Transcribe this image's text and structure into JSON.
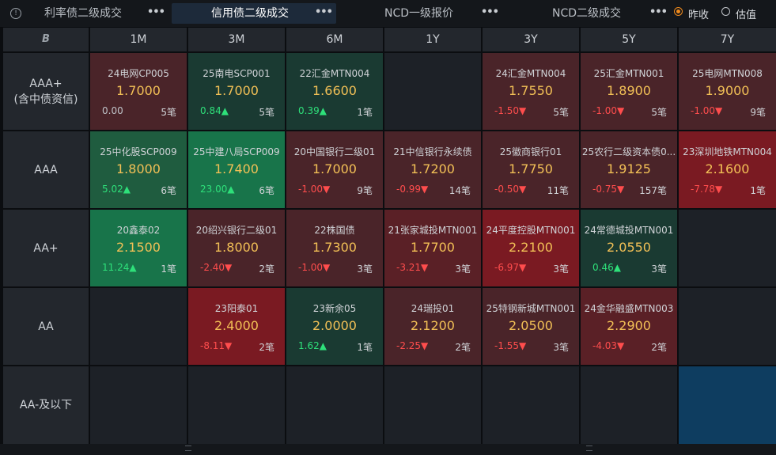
{
  "tabs": [
    {
      "label": "利率债二级成交",
      "dots": "•••"
    },
    {
      "label": "信用债二级成交",
      "dots": "•••"
    },
    {
      "label": "NCD一级报价",
      "dots": "•••"
    },
    {
      "label": "NCD二级成交",
      "dots": "•••"
    }
  ],
  "radios": {
    "option1": "昨收",
    "option2": "估值",
    "selected": "昨收"
  },
  "corner_icon": "B",
  "tenors": [
    "1M",
    "3M",
    "6M",
    "1Y",
    "3Y",
    "5Y",
    "7Y"
  ],
  "ratings": [
    "AAA+\n(含中债资信)",
    "AAA",
    "AA+",
    "AA",
    "AA-及以下"
  ],
  "colors": {
    "green_strong": "#18744a",
    "green_dark": "#1a3a32",
    "red_strong": "#7a1a22",
    "red_dark": "#4a2429",
    "empty": "#1d2127",
    "blue": "#0e3d60",
    "price": "#f2c056",
    "up": "#2ee07a",
    "down": "#ff4d4d"
  },
  "cells": [
    [
      {
        "name": "24电网CP005",
        "price": "1.7000",
        "change": "0.00",
        "dir": "flat",
        "count": "5笔",
        "tone": "red_dark"
      },
      {
        "name": "25南电SCP001",
        "price": "1.7000",
        "change": "0.84▲",
        "dir": "up",
        "count": "5笔",
        "tone": "green_dark"
      },
      {
        "name": "22汇金MTN004",
        "price": "1.6600",
        "change": "0.39▲",
        "dir": "up",
        "count": "1笔",
        "tone": "green_dark"
      },
      {
        "tone": "empty"
      },
      {
        "name": "24汇金MTN004",
        "price": "1.7550",
        "change": "-1.50▼",
        "dir": "down",
        "count": "5笔",
        "tone": "red_dark"
      },
      {
        "name": "25汇金MTN001",
        "price": "1.8900",
        "change": "-1.00▼",
        "dir": "down",
        "count": "5笔",
        "tone": "red_dark"
      },
      {
        "name": "25电网MTN008",
        "price": "1.9000",
        "change": "-1.00▼",
        "dir": "down",
        "count": "9笔",
        "tone": "red_dark"
      }
    ],
    [
      {
        "name": "25中化股SCP009",
        "price": "1.8000",
        "change": "5.02▲",
        "dir": "up",
        "count": "6笔",
        "tone": "green_mid"
      },
      {
        "name": "25中建八局SCP009",
        "price": "1.7400",
        "change": "23.00▲",
        "dir": "up",
        "count": "6笔",
        "tone": "green_strong"
      },
      {
        "name": "20中国银行二级01",
        "price": "1.7000",
        "change": "-1.00▼",
        "dir": "down",
        "count": "9笔",
        "tone": "red_dark"
      },
      {
        "name": "21中信银行永续债",
        "price": "1.7200",
        "change": "-0.99▼",
        "dir": "down",
        "count": "14笔",
        "tone": "red_dark"
      },
      {
        "name": "25徽商银行01",
        "price": "1.7750",
        "change": "-0.50▼",
        "dir": "down",
        "count": "11笔",
        "tone": "red_dark"
      },
      {
        "name": "25农行二级资本债0...",
        "price": "1.9125",
        "change": "-0.75▼",
        "dir": "down",
        "count": "157笔",
        "tone": "red_dark"
      },
      {
        "name": "23深圳地铁MTN004",
        "price": "2.1600",
        "change": "-7.78▼",
        "dir": "down",
        "count": "1笔",
        "tone": "red_strong"
      }
    ],
    [
      {
        "name": "20鑫泰02",
        "price": "2.1500",
        "change": "11.24▲",
        "dir": "up",
        "count": "1笔",
        "tone": "green_strong"
      },
      {
        "name": "20绍兴银行二级01",
        "price": "1.8000",
        "change": "-2.40▼",
        "dir": "down",
        "count": "2笔",
        "tone": "red_dark"
      },
      {
        "name": "22株国债",
        "price": "1.7300",
        "change": "-1.00▼",
        "dir": "down",
        "count": "3笔",
        "tone": "red_dark"
      },
      {
        "name": "21张家城投MTN001",
        "price": "1.7700",
        "change": "-3.21▼",
        "dir": "down",
        "count": "3笔",
        "tone": "red_mid"
      },
      {
        "name": "24平度控股MTN001",
        "price": "2.2100",
        "change": "-6.97▼",
        "dir": "down",
        "count": "3笔",
        "tone": "red_strong"
      },
      {
        "name": "24常德城投MTN001",
        "price": "2.0550",
        "change": "0.46▲",
        "dir": "up",
        "count": "3笔",
        "tone": "green_dark"
      },
      {
        "tone": "empty"
      }
    ],
    [
      {
        "tone": "empty"
      },
      {
        "name": "23阳泰01",
        "price": "2.4000",
        "change": "-8.11▼",
        "dir": "down",
        "count": "2笔",
        "tone": "red_strong"
      },
      {
        "name": "23新余05",
        "price": "2.0000",
        "change": "1.62▲",
        "dir": "up",
        "count": "1笔",
        "tone": "green_dark"
      },
      {
        "name": "24瑞投01",
        "price": "2.1200",
        "change": "-2.25▼",
        "dir": "down",
        "count": "2笔",
        "tone": "red_dark"
      },
      {
        "name": "25特钢新城MTN001",
        "price": "2.0500",
        "change": "-1.55▼",
        "dir": "down",
        "count": "3笔",
        "tone": "red_dark"
      },
      {
        "name": "24金华融盛MTN003",
        "price": "2.2900",
        "change": "-4.03▼",
        "dir": "down",
        "count": "2笔",
        "tone": "red_mid"
      },
      {
        "tone": "empty"
      }
    ],
    [
      {
        "tone": "empty"
      },
      {
        "tone": "empty"
      },
      {
        "tone": "empty"
      },
      {
        "tone": "empty"
      },
      {
        "tone": "empty"
      },
      {
        "tone": "empty"
      },
      {
        "tone": "blue"
      }
    ]
  ]
}
